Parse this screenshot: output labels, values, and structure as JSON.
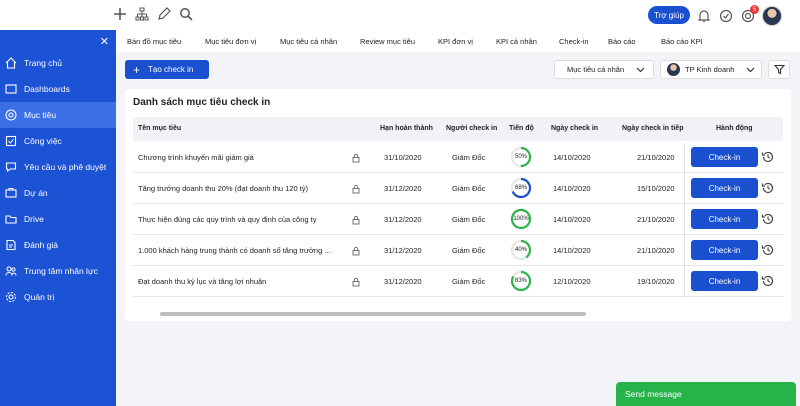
{
  "sidebar": {
    "items": [
      {
        "label": "Trang chủ",
        "icon": "home-icon"
      },
      {
        "label": "Dashboards",
        "icon": "dashboard-icon"
      },
      {
        "label": "Mục tiêu",
        "icon": "target-icon"
      },
      {
        "label": "Công việc",
        "icon": "tasks-icon"
      },
      {
        "label": "Yêu cầu và phê duyệt",
        "icon": "request-icon"
      },
      {
        "label": "Dự án",
        "icon": "project-icon"
      },
      {
        "label": "Drive",
        "icon": "folder-icon"
      },
      {
        "label": "Đánh giá",
        "icon": "review-icon"
      },
      {
        "label": "Trung tâm nhân lực",
        "icon": "people-icon"
      },
      {
        "label": "Quản trị",
        "icon": "gear-icon"
      }
    ],
    "active_index": 2
  },
  "header": {
    "help_label": "Trợ giúp",
    "notification_count": "5"
  },
  "tabs": [
    "Bản đồ mục tiêu",
    "Mục tiêu đơn vị",
    "Mục tiêu cá nhân",
    "Review mục tiêu",
    "KPI đơn vị",
    "KPI cá nhân",
    "Check-in",
    "Báo cáo",
    "Báo cáo KPI"
  ],
  "toolbar": {
    "create_label": "Tạo check in",
    "goal_filter": "Mục tiêu cá nhân",
    "user_filter": "TP Kinh doanh"
  },
  "table": {
    "title": "Danh sách mục tiêu check in",
    "columns": [
      "Tên mục tiêu",
      "Hạn hoàn thành",
      "Người check in",
      "Tiến độ",
      "Ngày check in",
      "Ngày check in tiếp",
      "Hành động"
    ],
    "rows": [
      {
        "name": "Chương trình khuyến mãi giảm giá",
        "due": "31/10/2020",
        "checker": "Giám Đốc",
        "progress": 50,
        "progress_label": "50%",
        "checkin_date": "14/10/2020",
        "next_date": "21/10/2020",
        "action": "Check-in"
      },
      {
        "name": "Tăng trưởng doanh thu 20% (đạt doanh thu 120 tỷ)",
        "due": "31/12/2020",
        "checker": "Giám Đốc",
        "progress": 68,
        "progress_label": "68%",
        "checkin_date": "14/10/2020",
        "next_date": "15/10/2020",
        "action": "Check-in"
      },
      {
        "name": "Thực hiện đúng các quy trình và quy định của công ty",
        "due": "31/12/2020",
        "checker": "Giám Đốc",
        "progress": 100,
        "progress_label": "100%",
        "checkin_date": "14/10/2020",
        "next_date": "21/10/2020",
        "action": "Check-in"
      },
      {
        "name": "1.000 khách hàng trung thành có doanh số tăng trưởng ...",
        "due": "31/12/2020",
        "checker": "Giám Đốc",
        "progress": 40,
        "progress_label": "40%",
        "checkin_date": "14/10/2020",
        "next_date": "21/10/2020",
        "action": "Check-in"
      },
      {
        "name": "Đạt doanh thu kỷ lục và tăng lợi nhuận",
        "due": "31/12/2020",
        "checker": "Giám Đốc",
        "progress": 83,
        "progress_label": "83%",
        "checkin_date": "12/10/2020",
        "next_date": "19/10/2020",
        "action": "Check-in"
      }
    ]
  },
  "send_message_label": "Send message",
  "colors": {
    "primary": "#1a4fd0",
    "sidebar": "#1c52d4",
    "sidebar_active": "#3b6fe6",
    "ring_green": "#2db34a",
    "ring_blue": "#1a4fd0",
    "send_green": "#26b34a"
  }
}
